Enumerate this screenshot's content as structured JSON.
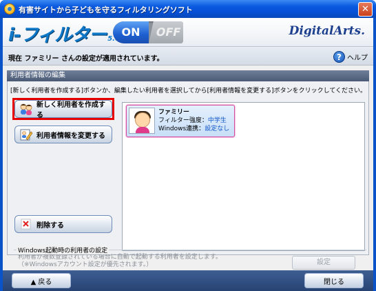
{
  "window": {
    "title": "有害サイトから子どもを守るフィルタリングソフト",
    "close_glyph": "✕"
  },
  "header": {
    "logo_text": "i-フィルター",
    "logo_version": "5.0",
    "toggle_on": "ON",
    "toggle_off": "OFF",
    "brand": "DigitalArts."
  },
  "status": {
    "text": "現在 ファミリー さんの設定が適用されています。",
    "help_glyph": "?",
    "help_label": "ヘルプ"
  },
  "user_edit": {
    "section_title": "利用者情報の編集",
    "instruction": "[新しく利用者を作成する]ボタンか、編集したい利用者を選択してから[利用者情報を変更する]ボタンをクリックしてください。",
    "create_button": "新しく利用者を作成する",
    "change_button": "利用者情報を変更する",
    "delete_button": "削除する",
    "users": [
      {
        "name": "ファミリー",
        "filter_label": "フィルター強度：",
        "filter_value": "中学生",
        "windows_label": "Windows連携：",
        "windows_value": "設定なし"
      }
    ]
  },
  "windows_login": {
    "group_title": "Windows起動時の利用者の設定",
    "description_line1": "利用者が複数登録されている場合に自動で起動する利用者を設定します。",
    "description_line2": "（※Windowsアカウント設定が優先されます。）",
    "setting_button": "設定"
  },
  "footer": {
    "back_button": "▲ 戻る",
    "close_button": "閉じる"
  }
}
